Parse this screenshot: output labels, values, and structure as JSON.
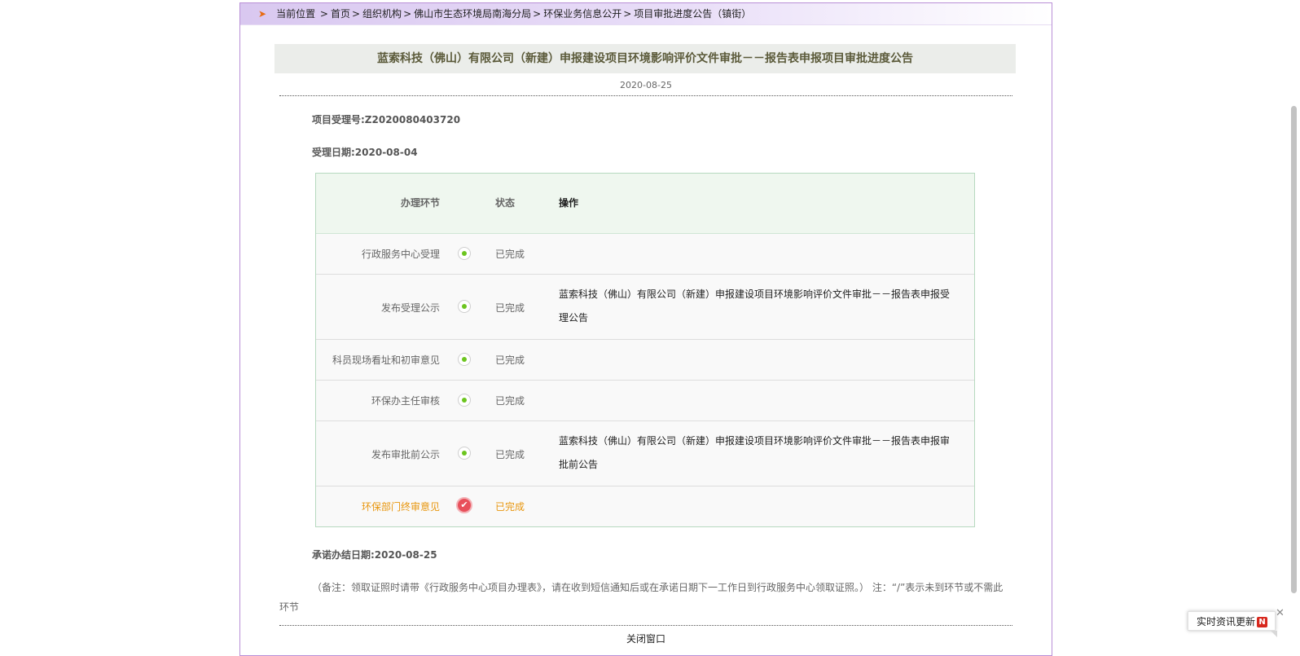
{
  "breadcrumb": {
    "prefix": "当前位置",
    "items": [
      "首页",
      "组织机构",
      "佛山市生态环境局南海分局",
      "环保业务信息公开",
      "项目审批进度公告（镇街）"
    ]
  },
  "title": "蓝索科技（佛山）有限公司（新建）申报建设项目环境影响评价文件审批－－报告表申报项目审批进度公告",
  "date": "2020-08-25",
  "info": {
    "project_no": "项目受理号:Z2020080403720",
    "accept_date": "受理日期:2020-08-04"
  },
  "table": {
    "headers": {
      "step": "办理环节",
      "status": "状态",
      "op": "操作"
    },
    "rows": [
      {
        "step": "行政服务中心受理",
        "status": "已完成",
        "op": ""
      },
      {
        "step": "发布受理公示",
        "status": "已完成",
        "op": "蓝索科技（佛山）有限公司（新建）申报建设项目环境影响评价文件审批－－报告表申报受理公告"
      },
      {
        "step": "科员现场看址和初审意见",
        "status": "已完成",
        "op": ""
      },
      {
        "step": "环保办主任审核",
        "status": "已完成",
        "op": ""
      },
      {
        "step": "发布审批前公示",
        "status": "已完成",
        "op": "蓝索科技（佛山）有限公司（新建）申报建设项目环境影响评价文件审批－－报告表申报审批前公告"
      },
      {
        "step": "环保部门终审意见",
        "status": "已完成",
        "op": ""
      }
    ]
  },
  "commit_date": "承诺办结日期:2020-08-25",
  "note": "（备注：领取证照时请带《行政服务中心项目办理表》，请在收到短信通知后或在承诺日期下一工作日到行政服务中心领取证照。） 注：“/”表示未到环节或不需此环节",
  "close_label": "关闭窗口",
  "news_widget": {
    "label": "实时资讯更新",
    "badge": "N",
    "close": "✕"
  },
  "colors": {
    "accent_orange": "#e8960e",
    "node_green": "#6cc51f",
    "final_red": "#e8505b"
  }
}
